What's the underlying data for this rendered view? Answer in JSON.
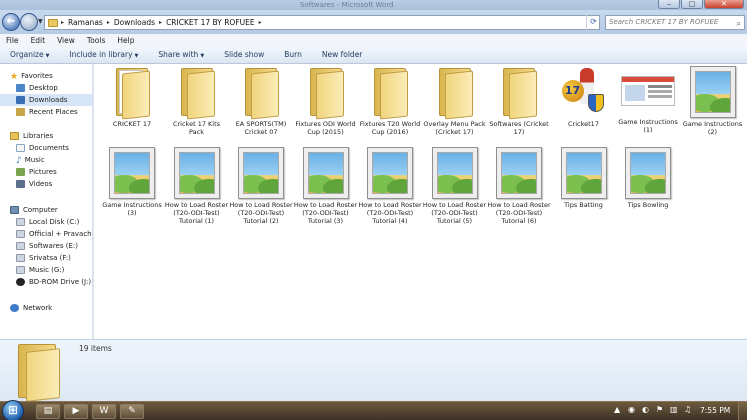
{
  "window": {
    "title": "Softwares - Microsoft Word",
    "controls": [
      "–",
      "□",
      "✕"
    ]
  },
  "address": {
    "crumbs": [
      "Ramanas",
      "Downloads",
      "CRICKET 17 BY ROFUEE"
    ],
    "search_placeholder": "Search CRICKET 17 BY ROFUEE"
  },
  "menu": [
    "File",
    "Edit",
    "View",
    "Tools",
    "Help"
  ],
  "toolbar": [
    "Organize",
    "Include in library",
    "Share with",
    "Slide show",
    "Burn",
    "New folder"
  ],
  "nav": {
    "favorites": "Favorites",
    "desktop": "Desktop",
    "downloads": "Downloads",
    "recent": "Recent Places",
    "libraries": "Libraries",
    "documents": "Documents",
    "music": "Music",
    "pictures": "Pictures",
    "videos": "Videos",
    "computer": "Computer",
    "drives": [
      "Local Disk (C:)",
      "Official + Pravachan",
      "Softwares (E:)",
      "Srivatsa (F:)",
      "Music (G:)",
      "BD-ROM Drive (J:) C"
    ],
    "network": "Network"
  },
  "files": [
    {
      "label": "CRICKET 17",
      "kind": "folder-paper"
    },
    {
      "label": "Cricket 17 Kits Pack",
      "kind": "folder"
    },
    {
      "label": "EA SPORTS(TM) Cricket 07",
      "kind": "folder"
    },
    {
      "label": "Fixtures ODI World Cup (2015)",
      "kind": "folder"
    },
    {
      "label": "Fixtures T20 World Cup (2016)",
      "kind": "folder"
    },
    {
      "label": "Overlay Menu Pack (Cricket 17)",
      "kind": "folder"
    },
    {
      "label": "Softwares (Cricket 17)",
      "kind": "folder"
    },
    {
      "label": "Cricket17",
      "kind": "app",
      "badge": "17"
    },
    {
      "label": "Game Instructions (1)",
      "kind": "thumb"
    },
    {
      "label": "Game Instructions (2)",
      "kind": "image"
    },
    {
      "label": "Game Instructions (3)",
      "kind": "image"
    },
    {
      "label": "How to Load Roster (T20-ODI-Test) Tutorial (1)",
      "kind": "image"
    },
    {
      "label": "How to Load Roster (T20-ODI-Test) Tutorial (2)",
      "kind": "image"
    },
    {
      "label": "How to Load Roster (T20-ODI-Test) Tutorial (3)",
      "kind": "image"
    },
    {
      "label": "How to Load Roster (T20-ODI-Test) Tutorial (4)",
      "kind": "image"
    },
    {
      "label": "How to Load Roster (T20-ODI-Test) Tutorial (5)",
      "kind": "image"
    },
    {
      "label": "How to Load Roster (T20-ODI-Test) Tutorial (6)",
      "kind": "image"
    },
    {
      "label": "Tips Batting",
      "kind": "image"
    },
    {
      "label": "Tips Bowling",
      "kind": "image"
    }
  ],
  "details": {
    "count": "19 items"
  },
  "taskbar": {
    "buttons": [
      "folder-icon",
      "media-icon",
      "word-icon",
      "paint-icon"
    ],
    "clock": "7:55 PM"
  }
}
